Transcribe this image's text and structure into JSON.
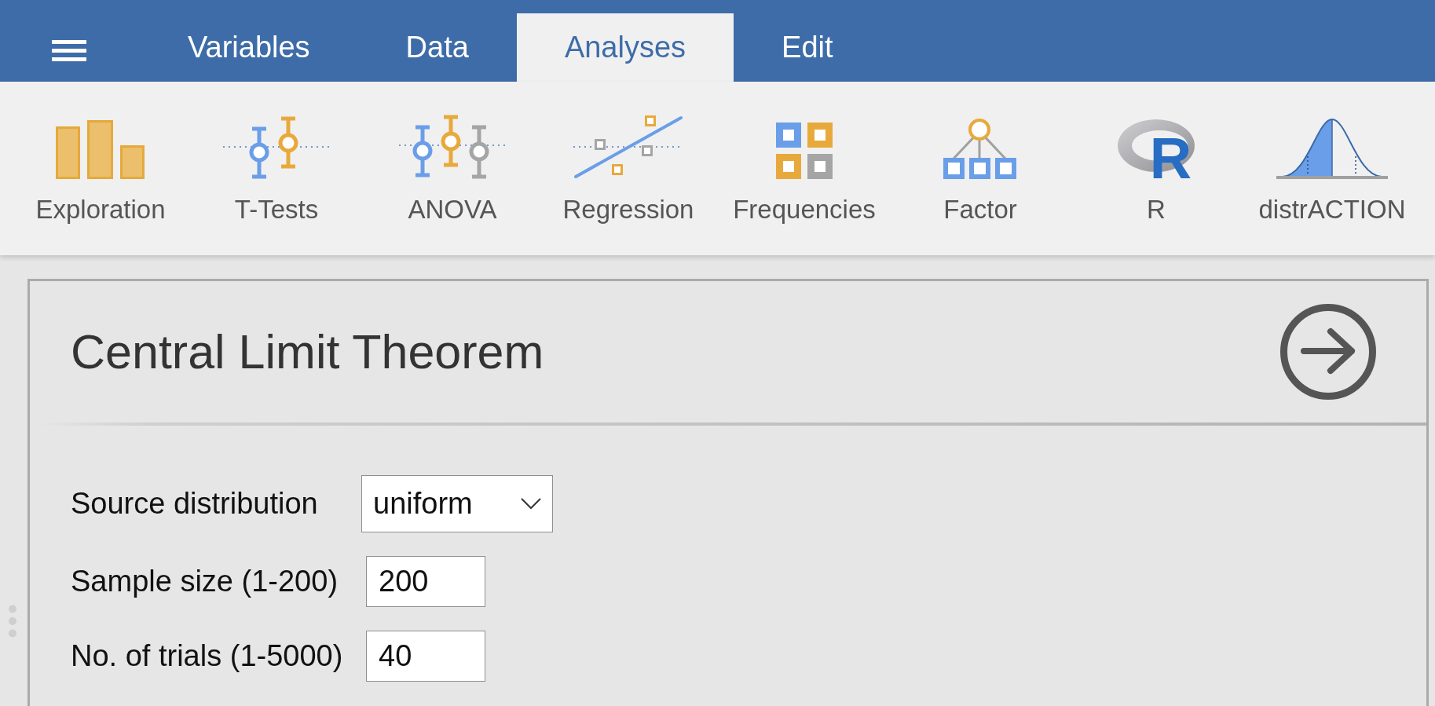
{
  "menu_bar": {
    "tabs": [
      {
        "label": "Variables",
        "selected": false
      },
      {
        "label": "Data",
        "selected": false
      },
      {
        "label": "Analyses",
        "selected": true
      },
      {
        "label": "Edit",
        "selected": false
      }
    ]
  },
  "toolbar": {
    "items": [
      {
        "kind": "exploration",
        "label": "Exploration"
      },
      {
        "kind": "t_tests",
        "label": "T-Tests"
      },
      {
        "kind": "anova",
        "label": "ANOVA"
      },
      {
        "kind": "regression",
        "label": "Regression"
      },
      {
        "kind": "frequencies",
        "label": "Frequencies"
      },
      {
        "kind": "factor",
        "label": "Factor"
      },
      {
        "kind": "r_logo",
        "label": "R",
        "logo_text": "R"
      },
      {
        "kind": "distribution",
        "label": "distrACTION"
      }
    ]
  },
  "panel": {
    "title": "Central Limit Theorem",
    "fields": [
      {
        "kind": "select",
        "label": "Source distribution",
        "value": "uniform"
      },
      {
        "kind": "number",
        "label": "Sample size (1-200)",
        "value": "200"
      },
      {
        "kind": "number",
        "label": "No. of trials (1-5000)",
        "value": "40"
      }
    ]
  }
}
